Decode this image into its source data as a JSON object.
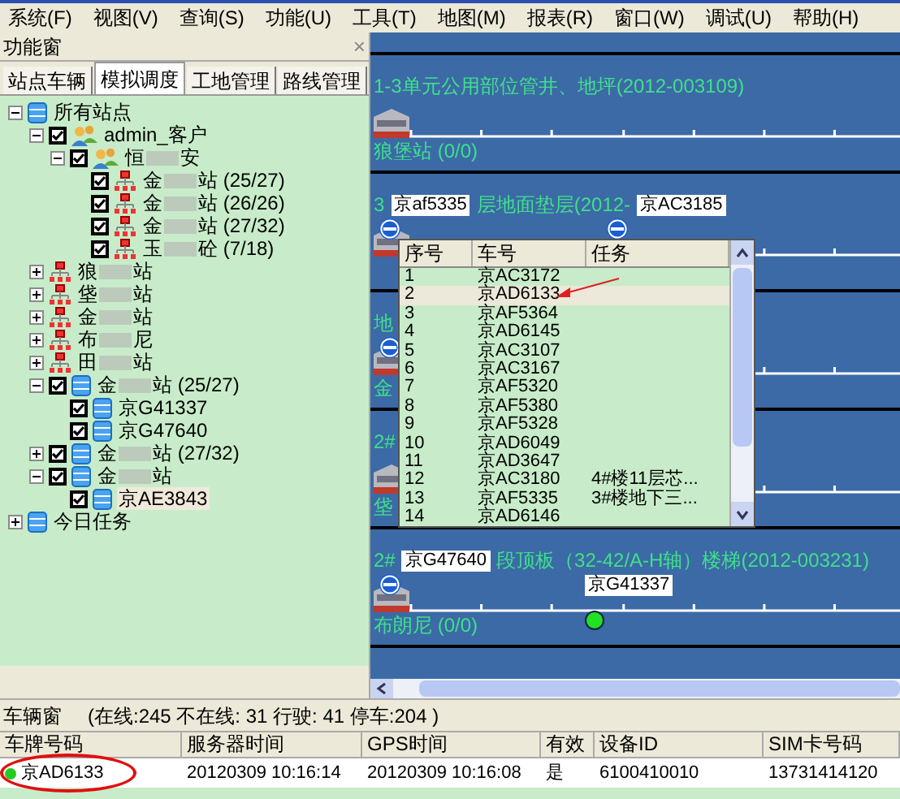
{
  "menu": [
    "系统(F)",
    "视图(V)",
    "查询(S)",
    "功能(U)",
    "工具(T)",
    "地图(M)",
    "报表(R)",
    "窗口(W)",
    "调试(U)",
    "帮助(H)"
  ],
  "side_panel": {
    "title": "功能窗",
    "close": "×",
    "tabs": [
      {
        "label": "站点车辆",
        "selected": false
      },
      {
        "label": "模拟调度",
        "selected": true
      },
      {
        "label": "工地管理",
        "selected": false
      },
      {
        "label": "路线管理",
        "selected": false
      }
    ],
    "tree": [
      {
        "kind": "database",
        "label": "所有站点",
        "expanded": true,
        "children": [
          {
            "kind": "group",
            "label": "admin_客户",
            "checked": true,
            "expanded": true,
            "children": [
              {
                "kind": "group",
                "label": "恒",
                "label_end": "安",
                "checked": true,
                "expanded": true,
                "children": [
                  {
                    "kind": "station",
                    "label": "金",
                    "label_end": "站 (25/27)",
                    "checked": true
                  },
                  {
                    "kind": "station",
                    "label": "金",
                    "label_end": "站 (26/26)",
                    "checked": true
                  },
                  {
                    "kind": "station",
                    "label": "金",
                    "label_end": "站 (27/32)",
                    "checked": true
                  },
                  {
                    "kind": "station",
                    "label": "玉",
                    "label_end": "砼 (7/18)",
                    "checked": true
                  }
                ]
              }
            ]
          },
          {
            "kind": "station",
            "label": "狼",
            "label_end": "站",
            "expanded": false
          },
          {
            "kind": "station",
            "label": "垡",
            "label_end": "站",
            "expanded": false
          },
          {
            "kind": "station",
            "label": "金",
            "label_end": "站",
            "expanded": false
          },
          {
            "kind": "station",
            "label": "布",
            "label_end": "尼",
            "expanded": false
          },
          {
            "kind": "station",
            "label": "田",
            "label_end": "站",
            "expanded": false
          },
          {
            "kind": "database",
            "label": "金",
            "label_end": "站 (25/27)",
            "checked": true,
            "expanded": true,
            "children": [
              {
                "kind": "database",
                "label": "京G41337",
                "checked": true
              },
              {
                "kind": "database",
                "label": "京G47640",
                "checked": true
              }
            ]
          },
          {
            "kind": "database",
            "label": "金",
            "label_end": "站 (27/32)",
            "checked": true,
            "expanded": false
          },
          {
            "kind": "database",
            "label": "金",
            "label_end": "站",
            "checked": true,
            "expanded": true,
            "children": [
              {
                "kind": "database",
                "label": "京AE3843",
                "checked": true,
                "selected": true
              }
            ]
          }
        ]
      },
      {
        "kind": "database",
        "label": "今日任务",
        "expanded": false
      }
    ]
  },
  "map": {
    "lanes": [
      {
        "title": "1-3单元公用部位管井、地坪(2012-003109)",
        "station": "狼堡站 (0/0)"
      },
      {
        "title_start": "3",
        "title": "层地面垫层(2012-",
        "tags": [
          {
            "label": "京af5335",
            "moving": false
          },
          {
            "label": "京AC3185",
            "moving": false
          }
        ]
      },
      {
        "title": "地",
        "station": "金"
      },
      {
        "title": "2#",
        "station": "垡"
      },
      {
        "title_start": "2#",
        "title": "段顶板（32-42/A-H轴）楼梯(2012-003231)",
        "station": "布朗尼 (0/0)",
        "tags": [
          {
            "label": "京G47640",
            "moving": false
          },
          {
            "label": "京G41337",
            "moving": true
          }
        ]
      }
    ],
    "popup": {
      "columns": [
        "序号",
        "车号",
        "任务"
      ],
      "rows": [
        {
          "cells": [
            "1",
            "京AC3172",
            ""
          ],
          "selected": false
        },
        {
          "cells": [
            "2",
            "京AD6133",
            ""
          ],
          "selected": true
        },
        {
          "cells": [
            "3",
            "京AF5364",
            ""
          ],
          "selected": false
        },
        {
          "cells": [
            "4",
            "京AD6145",
            ""
          ],
          "selected": false
        },
        {
          "cells": [
            "5",
            "京AC3107",
            ""
          ],
          "selected": false
        },
        {
          "cells": [
            "6",
            "京AC3167",
            ""
          ],
          "selected": false
        },
        {
          "cells": [
            "7",
            "京AF5320",
            ""
          ],
          "selected": false
        },
        {
          "cells": [
            "8",
            "京AF5380",
            ""
          ],
          "selected": false
        },
        {
          "cells": [
            "9",
            "京AF5328",
            ""
          ],
          "selected": false
        },
        {
          "cells": [
            "10",
            "京AD6049",
            ""
          ],
          "selected": false
        },
        {
          "cells": [
            "11",
            "京AD3647",
            ""
          ],
          "selected": false
        },
        {
          "cells": [
            "12",
            "京AC3180",
            "4#楼11层芯..."
          ],
          "selected": false
        },
        {
          "cells": [
            "13",
            "京AF5335",
            "3#楼地下三..."
          ],
          "selected": false
        },
        {
          "cells": [
            "14",
            "京AD6146",
            ""
          ],
          "selected": false
        }
      ]
    }
  },
  "vehicle_window": {
    "title": "车辆窗",
    "summary": "(在线:245 不在线: 31 行驶: 41 停车:204 )",
    "columns": [
      "车牌号码",
      "服务器时间",
      "GPS时间",
      "有效",
      "设备ID",
      "SIM卡号码"
    ],
    "rows": [
      {
        "cells": [
          "京AD6133",
          "20120309 10:16:14",
          "20120309 10:16:08",
          "是",
          "6100410010",
          "13731414120"
        ],
        "color": "#22cc22"
      }
    ]
  }
}
